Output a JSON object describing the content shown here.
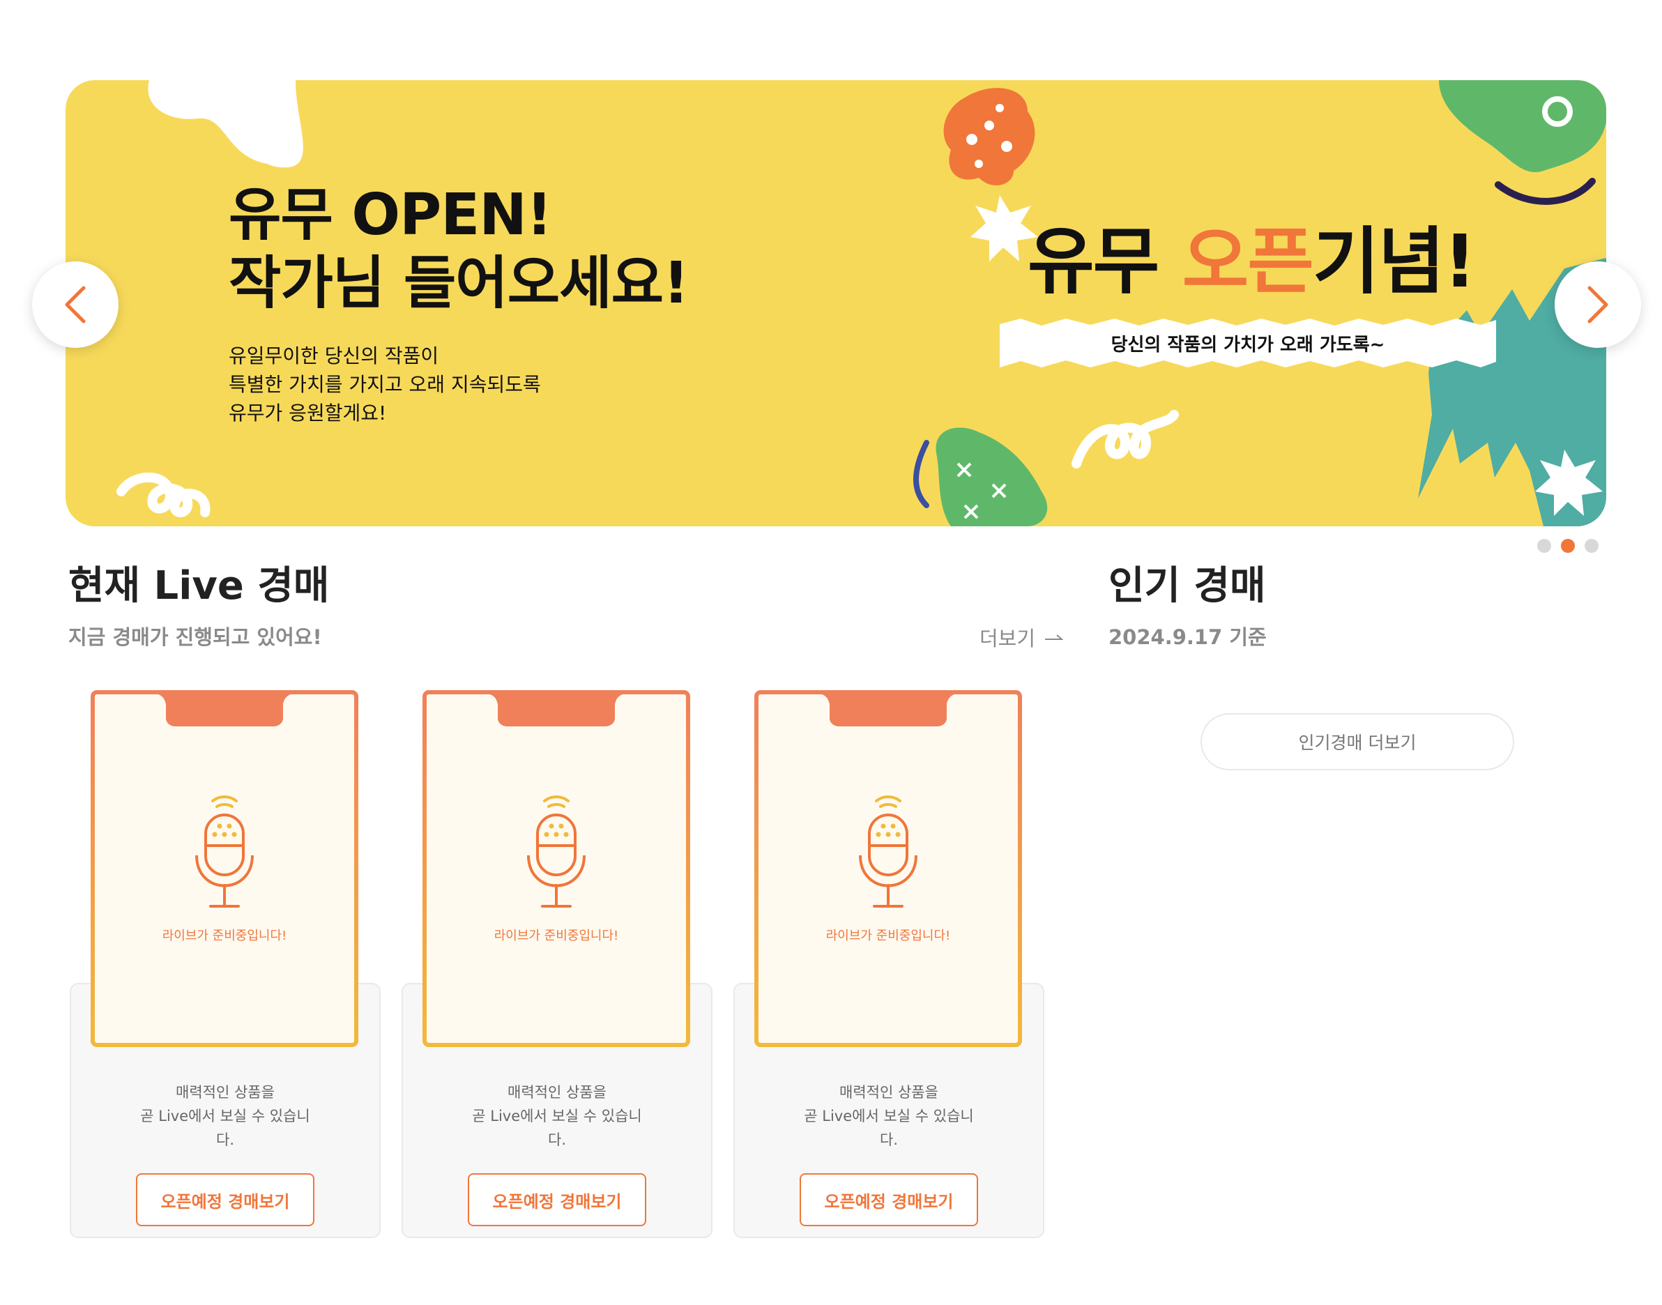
{
  "banner": {
    "title_line1": "유무 OPEN!",
    "title_line2": "작가님 들어오세요!",
    "desc_line1": "유일무이한 당신의 작품이",
    "desc_line2": "특별한 가치를 가지고 오래 지속되도록",
    "desc_line3": "유무가 응원할게요!",
    "promo_title_part1": "유무 ",
    "promo_title_highlight": "오픈",
    "promo_title_part2": "기념!",
    "promo_subtitle": "당신의 작품의 가치가 오래 가도록~",
    "background_color": "#f7d95a",
    "highlight_color": "#f0763a",
    "prev_icon": "chevron-left-icon",
    "next_icon": "chevron-right-icon",
    "slide_count": 3,
    "active_slide": 2
  },
  "live_section": {
    "title": "현재 Live 경매",
    "subtitle": "지금 경매가 진행되고 있어요!",
    "more_label": "더보기",
    "more_icon": "arrow-right-icon",
    "cards": [
      {
        "status": "라이브가 준비중입니다!",
        "text_line1": "매력적인 상품을",
        "text_line2": "곧 Live에서 보실 수 있습니",
        "text_line3": "다.",
        "button_label": "오픈예정 경매보기",
        "icon": "microphone-icon"
      },
      {
        "status": "라이브가 준비중입니다!",
        "text_line1": "매력적인 상품을",
        "text_line2": "곧 Live에서 보실 수 있습니",
        "text_line3": "다.",
        "button_label": "오픈예정 경매보기",
        "icon": "microphone-icon"
      },
      {
        "status": "라이브가 준비중입니다!",
        "text_line1": "매력적인 상품을",
        "text_line2": "곧 Live에서 보실 수 있습니",
        "text_line3": "다.",
        "button_label": "오픈예정 경매보기",
        "icon": "microphone-icon"
      }
    ]
  },
  "popular_section": {
    "title": "인기 경매",
    "date_label": "2024.9.17 기준",
    "more_button": "인기경매 더보기"
  },
  "colors": {
    "accent": "#f0763a",
    "card_frame_top": "#f0805a",
    "card_frame_bottom": "#f2b93b",
    "card_inner": "#fffaf0"
  }
}
